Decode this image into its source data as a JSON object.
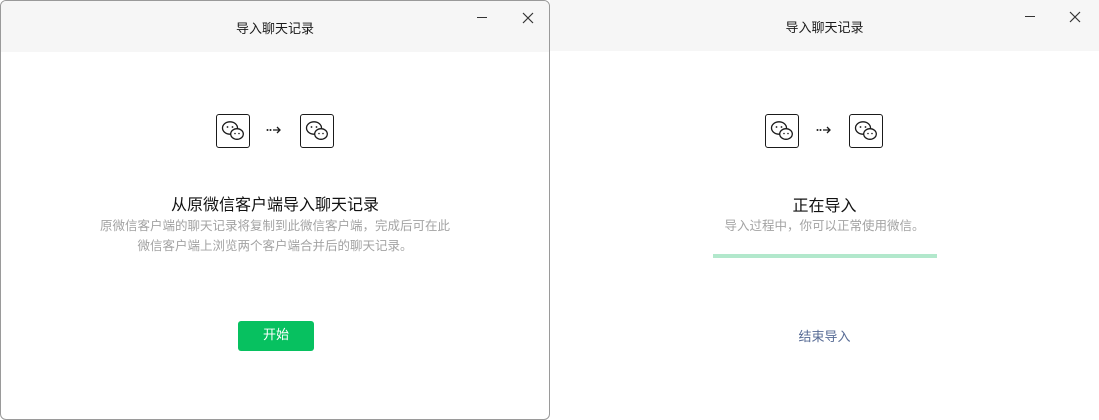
{
  "left_window": {
    "title": "导入聊天记录",
    "heading": "从原微信客户端导入聊天记录",
    "description_line1": "原微信客户端的聊天记录将复制到此微信客户端，完成后可在此",
    "description_line2": "微信客户端上浏览两个客户端合并后的聊天记录。",
    "start_button_label": "开始"
  },
  "right_window": {
    "title": "导入聊天记录",
    "heading": "正在导入",
    "description": "导入过程中，你可以正常使用微信。",
    "progress_fraction": 0.0,
    "end_import_label": "结束导入"
  },
  "icons": {
    "source_app": "wechat-icon",
    "transfer": "dotted-arrow-icon",
    "target_app": "wechat-icon",
    "minimize": "minimize-icon",
    "close": "close-icon"
  },
  "colors": {
    "accent_green": "#07c160",
    "progress_track": "#b2e8cc",
    "link_blue": "#576b95"
  }
}
